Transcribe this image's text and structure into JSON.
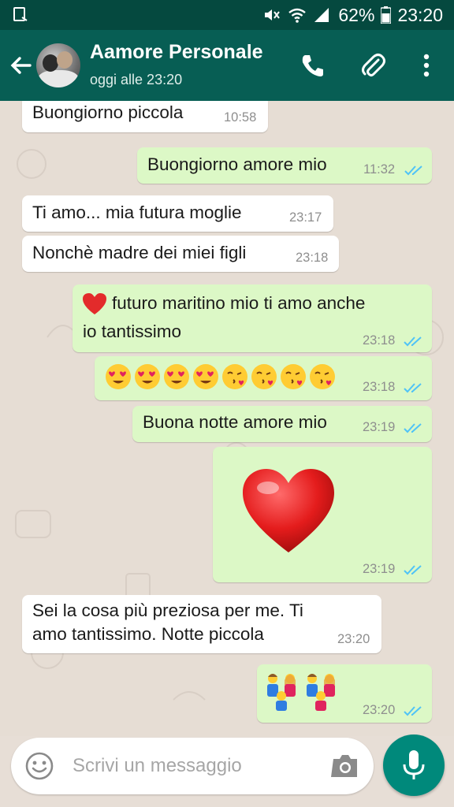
{
  "status_bar": {
    "battery": "62%",
    "time": "23:20",
    "icons": [
      "screenshot-icon",
      "mute-icon",
      "wifi-icon",
      "signal-icon",
      "battery-icon"
    ]
  },
  "header": {
    "contact_name": "Aamore Personale",
    "last_seen": "oggi alle 23:20",
    "icons": [
      "back-arrow-icon",
      "phone-icon",
      "paperclip-icon",
      "more-vert-icon"
    ],
    "background": "#075e54"
  },
  "messages": [
    {
      "dir": "in",
      "text": "Buongiorno piccola",
      "time": "10:58"
    },
    {
      "dir": "out",
      "text": "Buongiorno amore mio",
      "time": "11:32",
      "read": true
    },
    {
      "dir": "in",
      "text": "Ti amo... mia futura moglie",
      "time": "23:17"
    },
    {
      "dir": "in",
      "text": "Nonchè madre dei miei figli",
      "time": "23:18"
    },
    {
      "dir": "out",
      "text_line1": "futuro maritino mio ti amo anche",
      "text_line2": "io tantissimo",
      "emoji": "red-heart",
      "time": "23:18",
      "read": true
    },
    {
      "dir": "out",
      "emojis": [
        "heart-eyes",
        "heart-eyes",
        "heart-eyes",
        "heart-eyes",
        "kissing-heart",
        "kissing-heart",
        "kissing-heart",
        "kissing-heart"
      ],
      "time": "23:18",
      "read": true
    },
    {
      "dir": "out",
      "text": "Buona notte amore mio",
      "time": "23:19",
      "read": true
    },
    {
      "dir": "out",
      "emoji": "big-red-heart",
      "time": "23:19",
      "read": true
    },
    {
      "dir": "in",
      "text_line1": "Sei la cosa più preziosa per me. Ti",
      "text_line2": "amo tantissimo. Notte piccola",
      "time": "23:20"
    },
    {
      "dir": "out",
      "emojis": [
        "family-icon",
        "family-icon"
      ],
      "time": "23:20",
      "read": true
    }
  ],
  "composer": {
    "placeholder": "Scrivi un messaggio",
    "icons": [
      "emoji-icon",
      "camera-icon",
      "mic-icon"
    ]
  },
  "colors": {
    "outgoing_bubble": "#dcf8c6",
    "incoming_bubble": "#ffffff",
    "read_ticks": "#4fc3f7",
    "fab": "#00897b"
  }
}
